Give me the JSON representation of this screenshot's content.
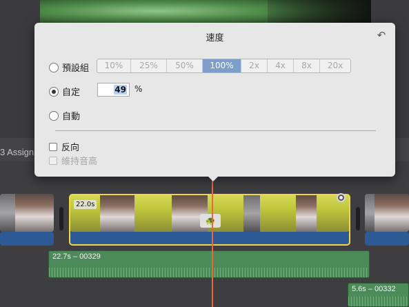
{
  "popover": {
    "title": "速度",
    "revert_icon": "revert-icon",
    "preset_label": "預設組",
    "presets": [
      "10%",
      "25%",
      "50%",
      "100%",
      "2x",
      "4x",
      "8x",
      "20x"
    ],
    "active_preset": "100%",
    "custom_label": "自定",
    "custom_value": "49",
    "percent_unit": "%",
    "auto_label": "自動",
    "reverse_label": "反向",
    "preserve_pitch_label": "維持音高"
  },
  "timeline": {
    "assign_label": "3 Assign",
    "clip_duration": "22.0s",
    "audio_clip_1": "22.7s – 00329",
    "audio_clip_2": "5.6s – 00332"
  },
  "colors": {
    "selection": "#f0d64b",
    "playhead": "#e8693c",
    "active_segment": "#7d9ec8",
    "audio_track": "#4d8a5a",
    "video_audio": "#2d5a94"
  }
}
